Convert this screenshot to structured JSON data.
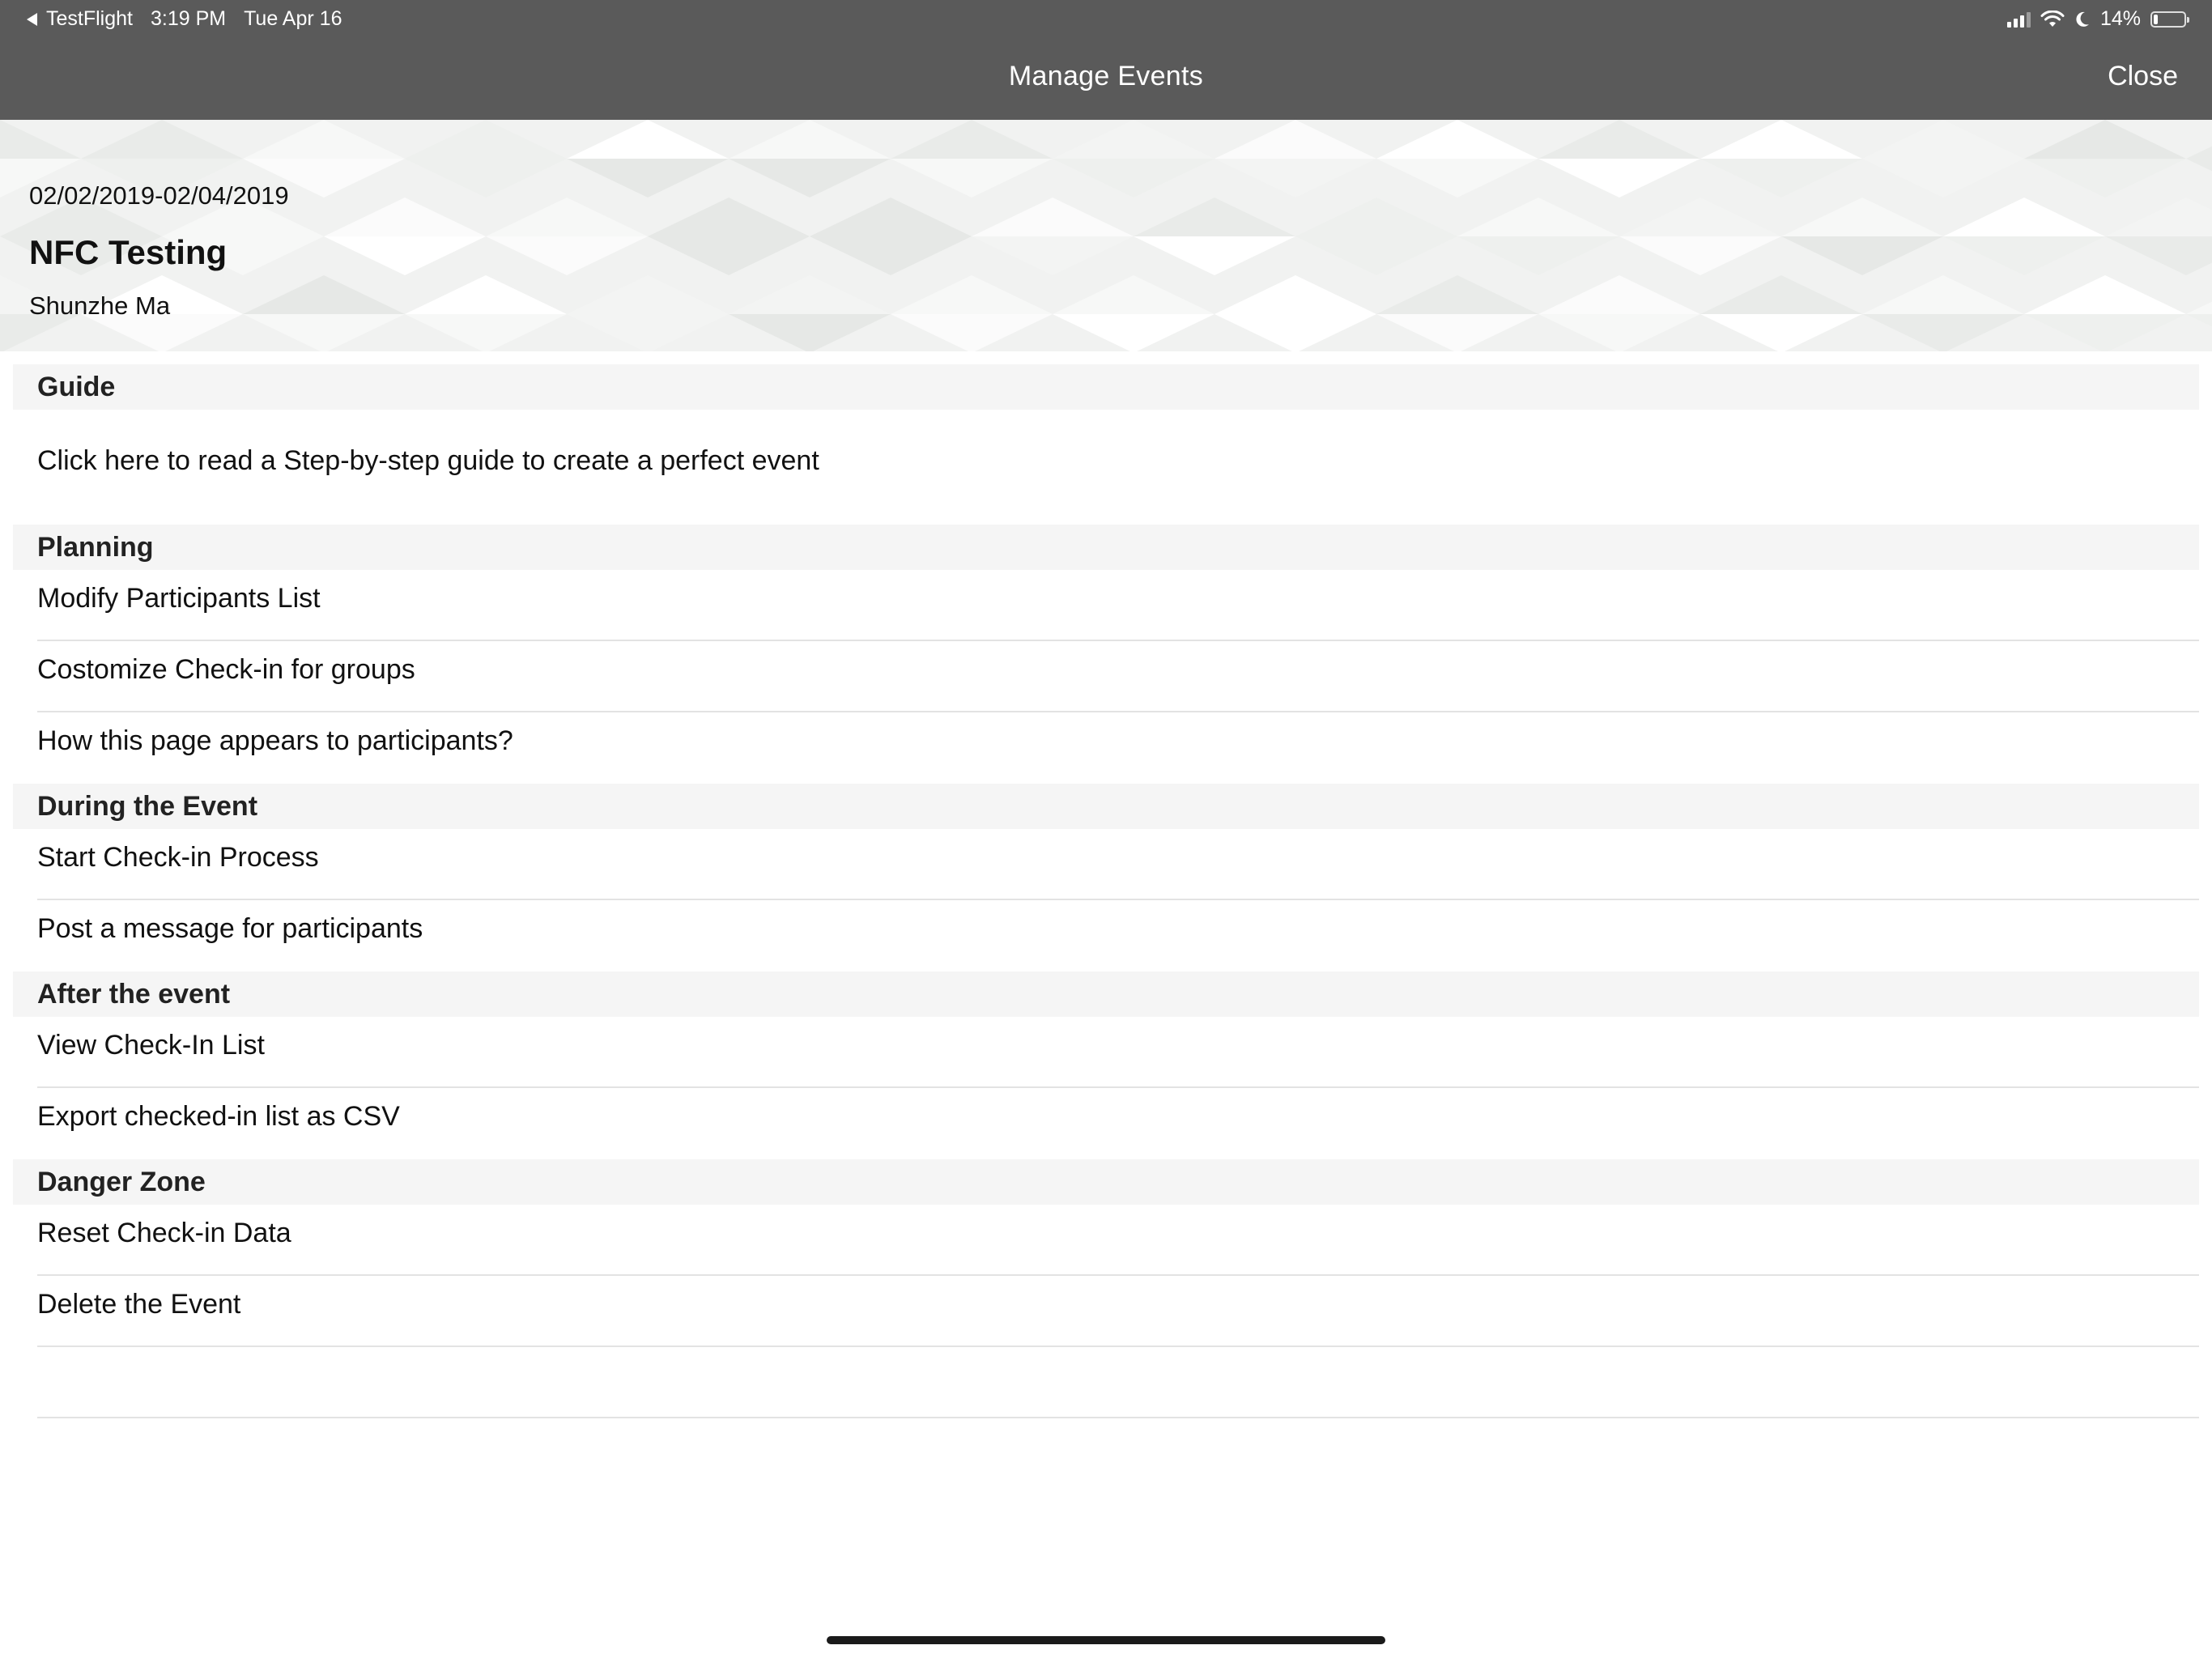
{
  "status_bar": {
    "back_app": "TestFlight",
    "time": "3:19 PM",
    "date": "Tue Apr 16",
    "battery_percent": "14%",
    "battery_level": 0.14,
    "signal_icon": "cellular-signal-icon",
    "wifi_icon": "wifi-icon",
    "moon_icon": "do-not-disturb-moon-icon",
    "battery_icon": "battery-icon"
  },
  "navbar": {
    "title": "Manage Events",
    "close_label": "Close",
    "background_color": "#5a5a5a"
  },
  "event": {
    "date_range": "02/02/2019-02/04/2019",
    "name": "NFC Testing",
    "organizer": "Shunzhe Ma"
  },
  "sections": {
    "guide": {
      "title": "Guide",
      "items": [
        "Click here to read a Step-by-step guide to create a perfect event"
      ]
    },
    "planning": {
      "title": "Planning",
      "items": [
        "Modify Participants List",
        "Costomize Check-in for groups",
        "How this page appears to participants?"
      ]
    },
    "during": {
      "title": "During the Event",
      "items": [
        "Start Check-in Process",
        "Post a message for participants"
      ]
    },
    "after": {
      "title": "After the event",
      "items": [
        "View Check-In List",
        "Export checked-in list as CSV"
      ]
    },
    "danger": {
      "title": "Danger Zone",
      "items": [
        "Reset Check-in Data",
        "Delete the Event",
        ""
      ]
    }
  }
}
